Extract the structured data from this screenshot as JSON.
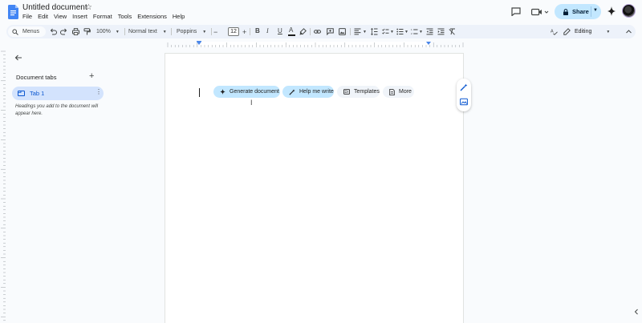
{
  "app": {
    "doc_title": "Untitled document",
    "menu": [
      "File",
      "Edit",
      "View",
      "Insert",
      "Format",
      "Tools",
      "Extensions",
      "Help"
    ],
    "share_label": "Share",
    "colors": {
      "accent": "#0b57d0",
      "share_bg": "#c2e7ff",
      "toolbar_bg": "#edf2fa",
      "background": "#f9fbfd"
    }
  },
  "toolbar": {
    "menus_label": "Menus",
    "zoom": "100%",
    "style": "Normal text",
    "font": "Poppins",
    "font_size": "12",
    "bold": "B",
    "italic": "I",
    "underline": "U",
    "text_color": "A",
    "mode": "Editing"
  },
  "sidebar": {
    "heading": "Document tabs",
    "add": "+",
    "tabs": [
      {
        "label": "Tab 1"
      }
    ],
    "hint": "Headings you add to the document will appear here."
  },
  "chips": [
    {
      "label": "Generate document",
      "icon": "sparkle-icon"
    },
    {
      "label": "Help me write",
      "icon": "pen-sparkle-icon"
    },
    {
      "label": "Templates",
      "icon": "template-icon"
    },
    {
      "label": "More",
      "icon": "more-doc-icon"
    }
  ]
}
